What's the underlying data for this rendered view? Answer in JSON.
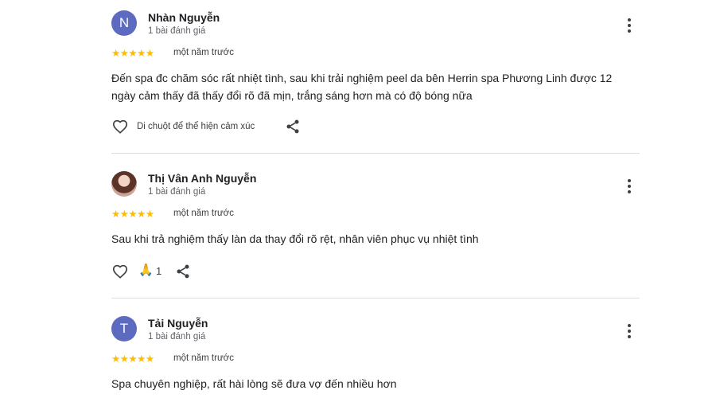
{
  "reviews": [
    {
      "avatar_letter": "N",
      "avatar_color": "#5c6bc0",
      "name": "Nhàn Nguyễn",
      "review_count": "1 bài đánh giá",
      "stars": "★★★★★",
      "rating": 5,
      "time": "một năm trước",
      "text": "Đến spa đc chăm sóc rất nhiệt tình, sau khi trải nghiệm peel da bên Herrin spa Phương Linh được 12 ngày cảm thấy đã thấy đổi rõ đã mịn, trắng sáng hơn mà có độ bóng nữa",
      "reaction_hint": "Di chuột để thể hiện cảm xúc"
    },
    {
      "avatar_letter": "",
      "avatar_color": "#6d3b2e",
      "name": "Thị Vân Anh Nguyễn",
      "review_count": "1 bài đánh giá",
      "stars": "★★★★★",
      "rating": 5,
      "time": "một năm trước",
      "text": "Sau khi trả nghiệm thấy làn da thay đổi rõ rệt, nhân viên phục vụ nhiệt tình",
      "reaction_emoji": "🙏",
      "reaction_count": "1"
    },
    {
      "avatar_letter": "T",
      "avatar_color": "#5c6bc0",
      "name": "Tải Nguyễn",
      "review_count": "1 bài đánh giá",
      "stars": "★★★★★",
      "rating": 5,
      "time": "một năm trước",
      "text": "Spa chuyên nghiệp, rất hài lòng sẽ đưa vợ đến nhiều hơn"
    }
  ],
  "colors": {
    "star": "#fbbc04",
    "divider": "#dadce0",
    "avatar_default": "#5c6bc0"
  },
  "icons": {
    "menu": "more-vert-icon",
    "heart": "heart-outline-icon",
    "share": "share-icon"
  }
}
